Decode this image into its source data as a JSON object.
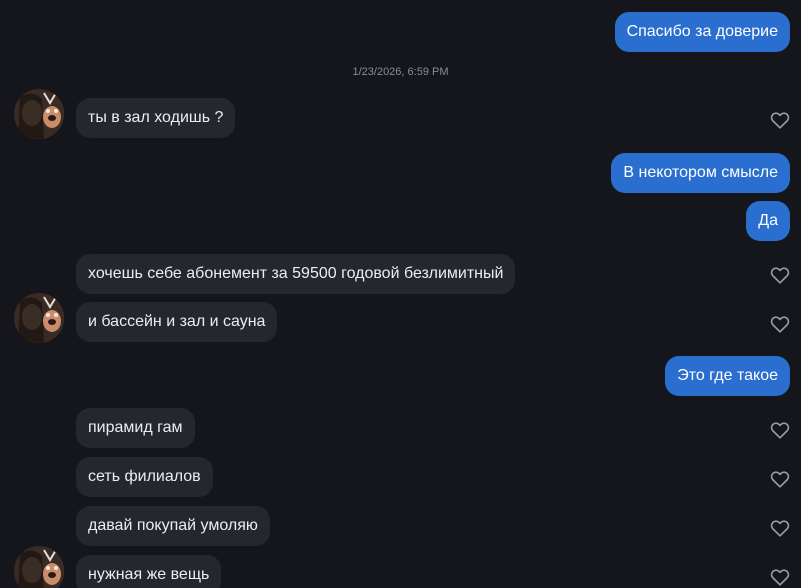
{
  "conversation": {
    "timestamp": "1/23/2026, 6:59 PM",
    "messages": [
      {
        "direction": "out",
        "text": "Спасибо за доверие"
      },
      {
        "direction": "in",
        "text": "ты в зал ходишь ?"
      },
      {
        "direction": "out",
        "text": "В некотором смысле"
      },
      {
        "direction": "out",
        "text": "Да"
      },
      {
        "direction": "in",
        "text": "хочешь себе абонемент за 59500 годовой безлимитный"
      },
      {
        "direction": "in",
        "text": "и бассейн и зал и сауна"
      },
      {
        "direction": "out",
        "text": "Это где такое"
      },
      {
        "direction": "in",
        "text": "пирамид гам"
      },
      {
        "direction": "in",
        "text": "сеть филиалов"
      },
      {
        "direction": "in",
        "text": "давай покупай умоляю"
      },
      {
        "direction": "in",
        "text": "нужная же вещь"
      }
    ]
  },
  "colors": {
    "background": "#15161c",
    "outgoing_bubble": "#2a6fd0",
    "incoming_bubble": "#26272e",
    "like_icon": "#9a9ca4"
  },
  "icons": {
    "like": "heart-outline-icon",
    "avatar": "user-avatar-photo"
  }
}
